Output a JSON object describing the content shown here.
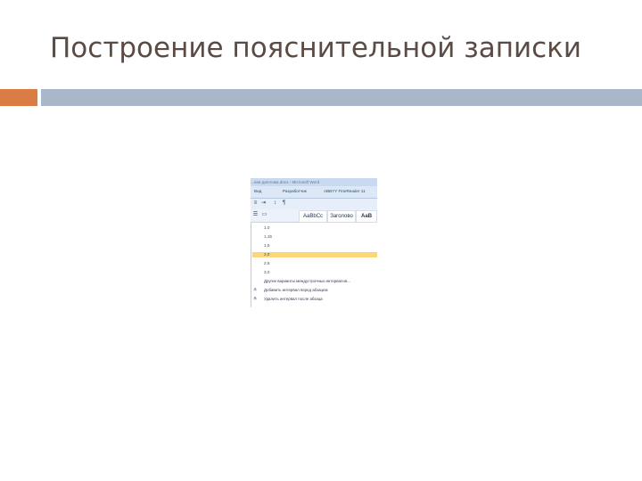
{
  "slide": {
    "title": "Построение пояснительной записки",
    "colors": {
      "orange": "#d97d45",
      "blue": "#a9b7c9",
      "title": "#5a4b45"
    }
  },
  "screenshot": {
    "window_title": "...ная диплома.docx - Microsoft Word",
    "tabs": [
      "Вид",
      "Разработчик",
      "ABBYY FineReader 11"
    ],
    "styles": [
      "АаВbСс",
      "АаВbСс",
      "АаВ"
    ],
    "style_caption": "Заголово",
    "spacing_values": [
      "1,0",
      "1,15",
      "1,5",
      "2,0",
      "2,5",
      "3,0"
    ],
    "selected_value": "2,0",
    "links": [
      "Другие варианты междустрочных интервалов...",
      "Добавить интервал перед абзацем",
      "Удалить интервал после абзаца"
    ]
  }
}
